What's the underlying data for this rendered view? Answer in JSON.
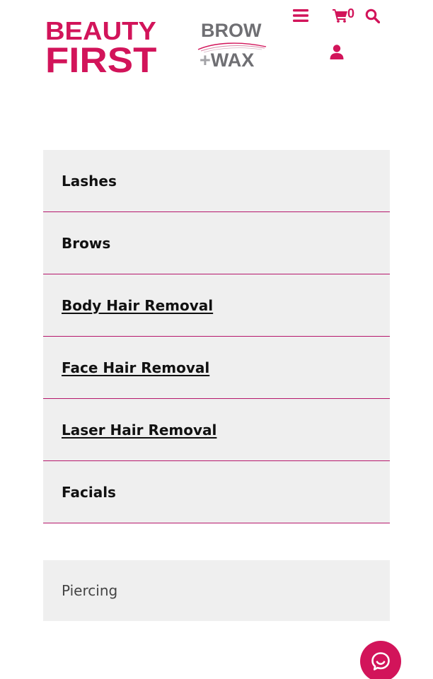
{
  "brand": {
    "logo_line1": "BEAUTY",
    "logo_line2": "FIRST",
    "sub_logo_line1": "BROW",
    "sub_logo_plus": "+",
    "sub_logo_wax": "WAX",
    "brand_color": "#d2145a"
  },
  "header": {
    "menu_icon": "hamburger-menu-icon",
    "cart_icon": "shopping-cart-icon",
    "cart_count": "0",
    "search_icon": "search-icon",
    "account_icon": "user-icon"
  },
  "categories": [
    {
      "label": "Lashes",
      "link": false
    },
    {
      "label": "Brows",
      "link": false
    },
    {
      "label": "Body Hair Removal",
      "link": true
    },
    {
      "label": "Face Hair Removal",
      "link": true
    },
    {
      "label": "Laser Hair Removal",
      "link": true
    },
    {
      "label": "Facials",
      "link": false
    }
  ],
  "secondary": {
    "piercing_label": "Piercing"
  },
  "chat": {
    "icon": "chat-bubble-icon"
  },
  "colors": {
    "accent": "#d2145a",
    "divider": "#b5176c",
    "item_bg": "#efefef"
  }
}
